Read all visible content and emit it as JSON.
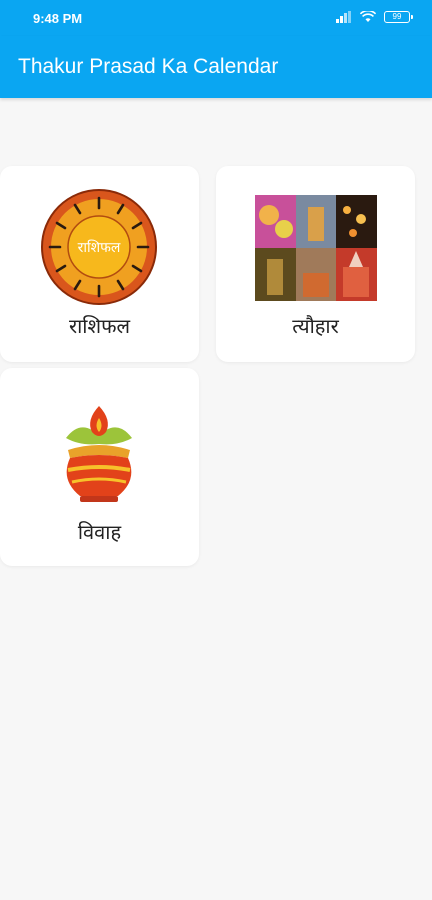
{
  "status_bar": {
    "time": "9:48 PM",
    "battery": "99",
    "icons": [
      "cellular-icon",
      "wifi-icon",
      "battery-icon"
    ]
  },
  "app_bar": {
    "title": "Thakur Prasad Ka Calendar"
  },
  "menu": {
    "items": [
      {
        "label": "राशिफल",
        "icon": "rashifal-zodiac-icon",
        "badge_text": "राशिफल"
      },
      {
        "label": "त्यौहार",
        "icon": "festival-collage-icon"
      },
      {
        "label": "विवाह",
        "icon": "kalash-icon"
      }
    ]
  },
  "colors": {
    "primary": "#0aa6f2",
    "background": "#f7f7f7",
    "card": "#ffffff"
  }
}
